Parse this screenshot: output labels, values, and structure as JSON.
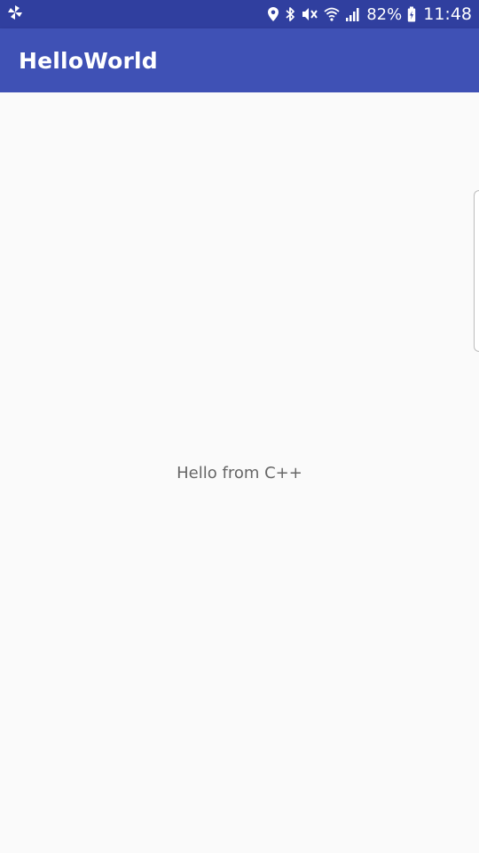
{
  "status_bar": {
    "notification_icon": "pinwheel-icon",
    "icons": [
      "location-icon",
      "bluetooth-icon",
      "mute-icon",
      "wifi-icon",
      "signal-icon",
      "battery-icon"
    ],
    "battery": "82%",
    "time": "11:48"
  },
  "app_bar": {
    "title": "HelloWorld"
  },
  "main": {
    "message": "Hello from C++"
  },
  "colors": {
    "status_bar": "#303f9f",
    "app_bar": "#3f51b5",
    "background": "#fafafa",
    "message_text": "#666666"
  }
}
